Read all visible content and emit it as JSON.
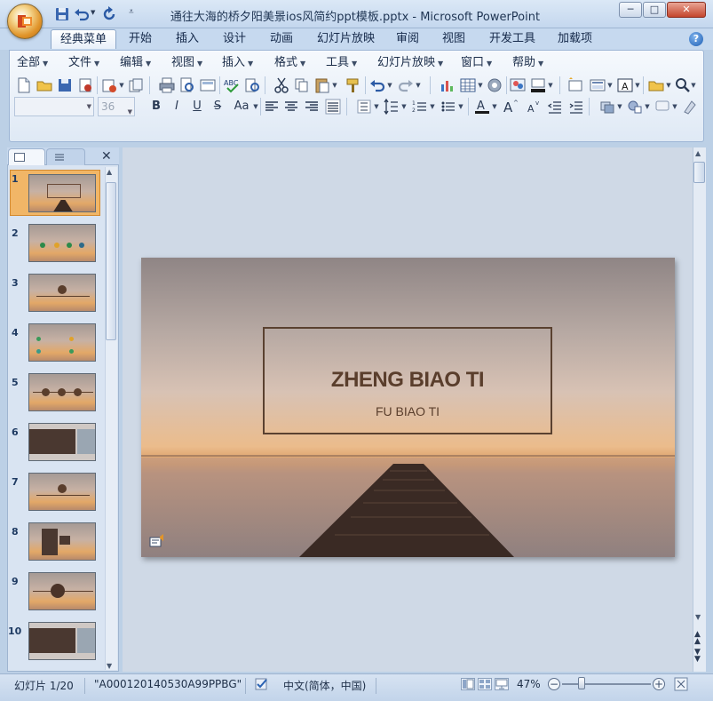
{
  "window": {
    "title": "通往大海的桥夕阳美景ios风简约ppt模板.pptx - Microsoft PowerPoint",
    "min": "─",
    "max": "□",
    "close": "✕"
  },
  "ribbon": {
    "tabs": [
      "经典菜单",
      "开始",
      "插入",
      "设计",
      "动画",
      "幻灯片放映",
      "审阅",
      "视图",
      "开发工具",
      "加载项"
    ],
    "active_tab": "经典菜单",
    "menus": [
      "全部",
      "文件",
      "编辑",
      "视图",
      "插入",
      "格式",
      "工具",
      "幻灯片放映",
      "窗口",
      "帮助"
    ],
    "font_name": "",
    "font_size": "36"
  },
  "slides_pane": {
    "numbers": [
      "1",
      "2",
      "3",
      "4",
      "5",
      "6",
      "7",
      "8",
      "9",
      "10"
    ],
    "selected": "1"
  },
  "slide": {
    "title": "ZHENG BIAO TI",
    "subtitle": "FU BIAO TI"
  },
  "status": {
    "slide_info": "幻灯片 1/20",
    "theme": "\"A000120140530A99PPBG\"",
    "language": "中文(简体，中国)",
    "zoom": "47%",
    "zoom_fraction": 0.47
  },
  "colors": {
    "accent": "#e0942a",
    "title_text": "#5a3e2c"
  }
}
